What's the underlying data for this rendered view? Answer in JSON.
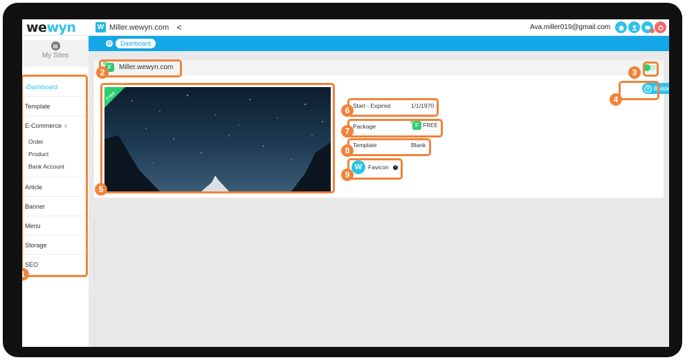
{
  "topbar": {
    "logo_we": "we",
    "logo_wyn": "wyn",
    "site_badge": "W",
    "site_name": "Miller.wewyn.com",
    "back_icon": "<",
    "user_email": "Ava.miller019@gmail.com",
    "icons": [
      "home-icon",
      "user-icon",
      "messages-icon",
      "logout-icon"
    ]
  },
  "sidebar": {
    "my_sites_label": "My Sites",
    "items": [
      {
        "label": "Dashboard",
        "active": true
      },
      {
        "label": "Template"
      },
      {
        "label": "E-Commerce",
        "expanded": true,
        "children": [
          "Order",
          "Product",
          "Bank Account"
        ]
      },
      {
        "label": "Article"
      },
      {
        "label": "Banner"
      },
      {
        "label": "Menu"
      },
      {
        "label": "Storage"
      },
      {
        "label": "SEO"
      }
    ]
  },
  "breadcrumb": {
    "label": "Dashboard"
  },
  "site_card": {
    "site_name": "Miller.wewyn.com",
    "package_letter": "F",
    "ribbon_label": "Free",
    "builder_label": "Builder",
    "start_expired_label": "Start - Expired",
    "start_expired_value": "1/1/1970",
    "package_label": "Package",
    "package_value": "FREE",
    "template_label": "Template",
    "template_value": "Blank",
    "favicon_letter": "W",
    "favicon_label": "Favicon",
    "help_icon": "?"
  },
  "annotations": [
    "1",
    "2",
    "3",
    "4",
    "5",
    "6",
    "7",
    "8",
    "9"
  ],
  "colors": {
    "accent": "#2ec3e8",
    "breadcrumb_bar": "#14a8e8",
    "annotation": "#f0833a",
    "package_green": "#2ecc71"
  }
}
